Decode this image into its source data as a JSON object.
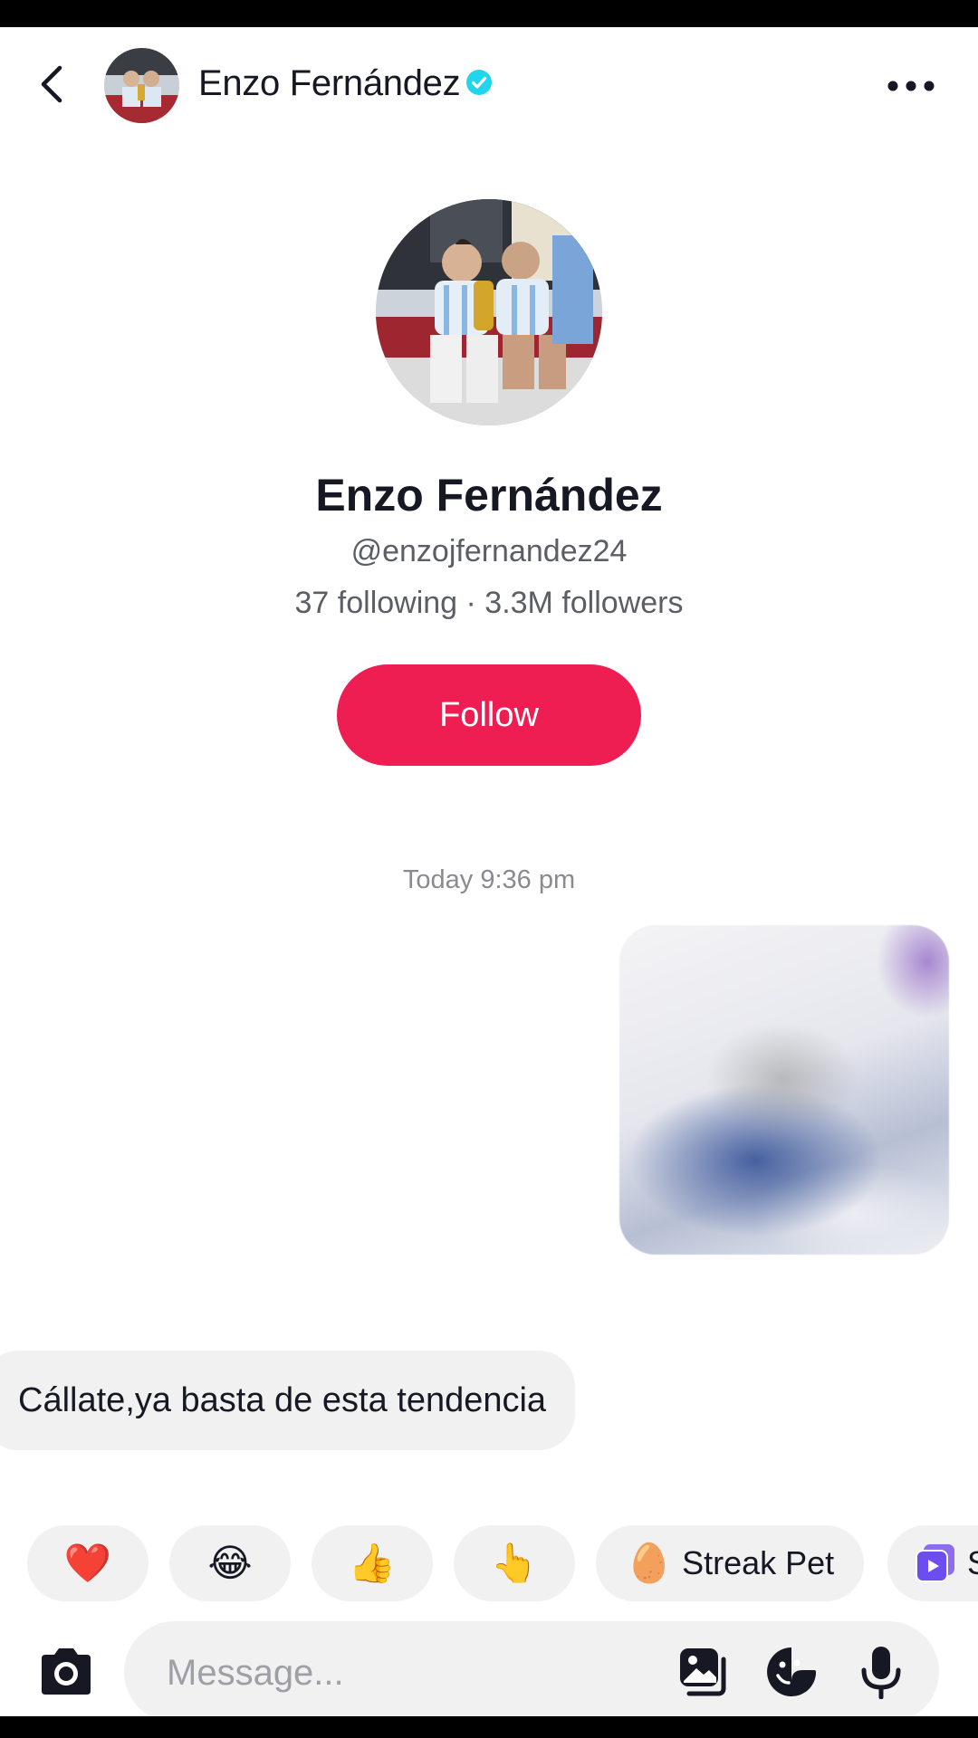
{
  "header": {
    "name": "Enzo Fernández",
    "back_icon": "chevron-left-icon",
    "more_icon": "more-dots-icon",
    "verified_icon": "verified-badge-icon",
    "verified_color": "#20D5EC"
  },
  "profile": {
    "name": "Enzo Fernández",
    "handle": "@enzojfernandez24",
    "stats": "37 following · 3.3M followers",
    "follow_label": "Follow",
    "follow_color": "#EE1D52"
  },
  "conversation": {
    "timestamp": "Today 9:36 pm",
    "messages": [
      {
        "type": "image",
        "blurred": true
      },
      {
        "type": "text",
        "text": "Cállate,ya basta de esta tendencia"
      }
    ]
  },
  "quick_reactions": [
    {
      "emoji": "❤️",
      "label": ""
    },
    {
      "emoji": "😂",
      "label": ""
    },
    {
      "emoji": "👍",
      "label": ""
    },
    {
      "emoji": "👆",
      "label": ""
    },
    {
      "emoji": "🥚",
      "label": "Streak Pet"
    },
    {
      "emoji": "",
      "label": "S"
    }
  ],
  "input_bar": {
    "placeholder": "Message...",
    "icons": [
      "camera-icon",
      "gallery-icon",
      "sticker-icon",
      "microphone-icon"
    ]
  }
}
